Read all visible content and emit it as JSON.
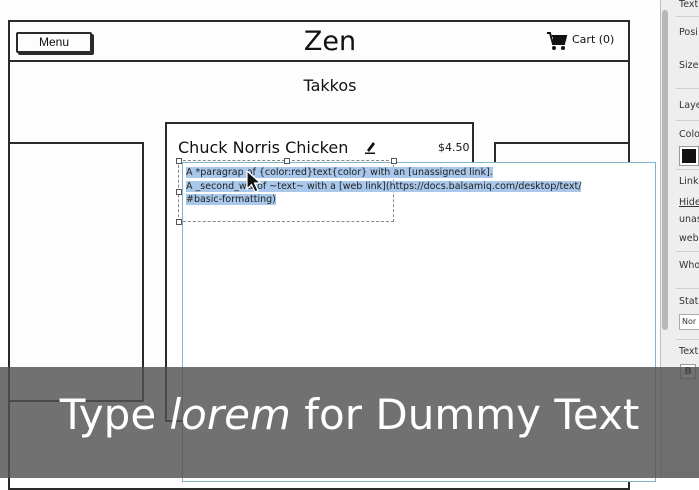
{
  "wireframe": {
    "menu_label": "Menu",
    "brand": "Zen",
    "cart_label": "Cart (0)",
    "page_subtitle": "Takkos",
    "dish": {
      "title": "Chuck Norris Chicken",
      "price": "$4.50"
    },
    "text_widget": {
      "line1": "A *paragrap",
      "line1_rest": " of {color:red}text{color} with an [unassigned link].",
      "line2": "A _second_",
      "line2_rest": "w& of ~text~ with a [web link](https://docs.balsamiq.com/desktop/text/",
      "line3": "#basic-formatting)"
    }
  },
  "properties_panel": {
    "labels": [
      "Text",
      "Posi",
      "Size",
      "Laye",
      "Colo",
      "Link",
      "Hide",
      "unas",
      "web",
      "Who",
      "Stat",
      "Text"
    ],
    "state_value": "Nor",
    "bold_label": "B"
  },
  "caption": {
    "prefix": "Type ",
    "italic_word": "lorem",
    "suffix": " for Dummy Text"
  },
  "icons": [
    "cart-icon",
    "pencil-icon",
    "cursor-icon"
  ],
  "colors": {
    "selection_highlight": "#a9c7ea",
    "widget_border": "#7fb6c9",
    "caption_bar": "#525252"
  }
}
